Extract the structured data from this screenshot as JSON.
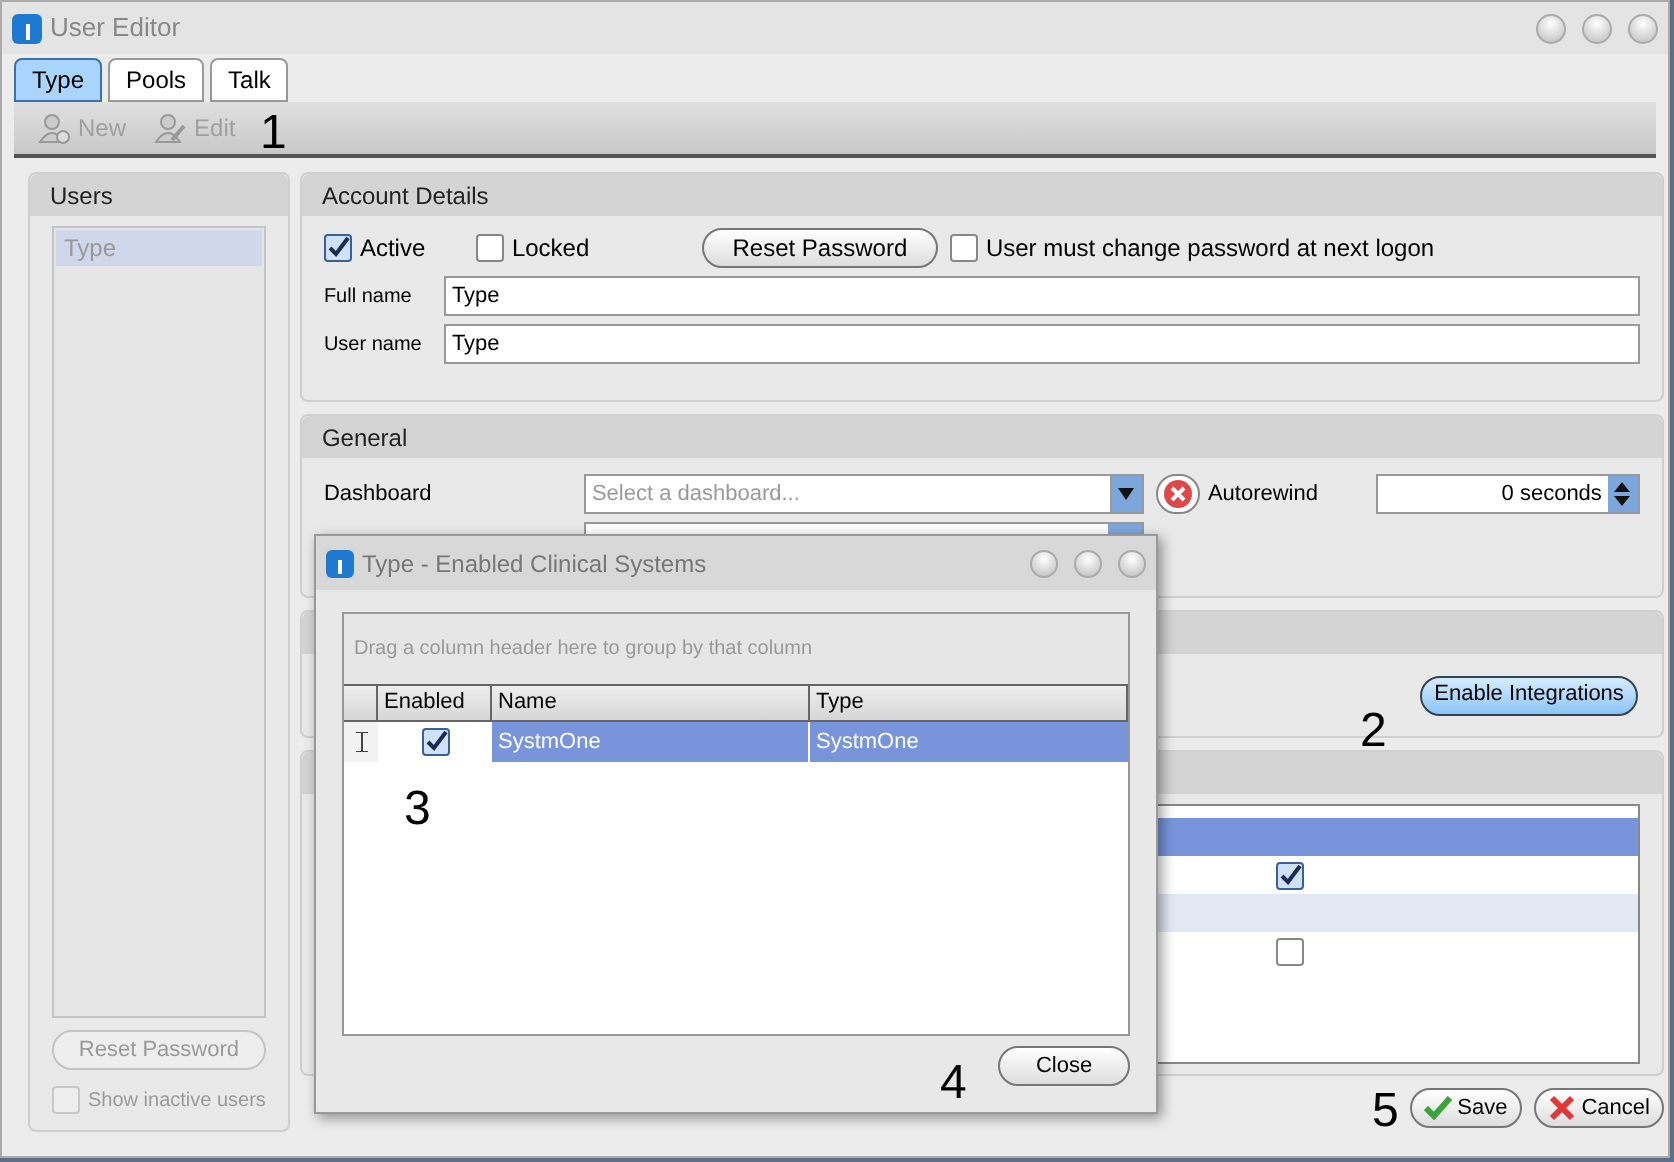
{
  "window": {
    "title": "User Editor"
  },
  "tabs": [
    {
      "label": "Type",
      "selected": true
    },
    {
      "label": "Pools",
      "selected": false
    },
    {
      "label": "Talk",
      "selected": false
    }
  ],
  "toolbar": [
    {
      "label": "New",
      "disabled": true,
      "kind": "new"
    },
    {
      "label": "Edit",
      "disabled": true,
      "kind": "edit"
    }
  ],
  "users_panel": {
    "title": "Users",
    "items": [
      {
        "label": "Type",
        "selected": true
      }
    ],
    "reset_button": {
      "label": "Reset Password",
      "disabled": true
    },
    "show_inactive": {
      "label": "Show inactive users",
      "checked": false,
      "disabled": true
    }
  },
  "account_details": {
    "title": "Account Details",
    "active": {
      "label": "Active",
      "checked": true
    },
    "locked": {
      "label": "Locked",
      "checked": false
    },
    "reset_button": "Reset Password",
    "must_change": {
      "label": "User must change password at next logon",
      "checked": false
    },
    "full_name": {
      "label": "Full name",
      "value": "Type"
    },
    "user_name": {
      "label": "User name",
      "value": "Type"
    }
  },
  "general": {
    "title": "General",
    "dashboard": {
      "label": "Dashboard",
      "placeholder": "Select a dashboard..."
    },
    "autorewind": {
      "label": "Autorewind",
      "value": "0 seconds"
    }
  },
  "integrations_panel": {
    "button": "Enable Integrations"
  },
  "systems_grid": {
    "rows": [
      {
        "selected": true,
        "kind": "empty"
      },
      {
        "selected": false,
        "kind": "checkbox",
        "checked": true
      },
      {
        "selected": false,
        "kind": "empty"
      },
      {
        "selected": false,
        "kind": "checkbox",
        "checked": false
      }
    ]
  },
  "footer": {
    "save": "Save",
    "cancel": "Cancel"
  },
  "dialog": {
    "title": "Type - Enabled Clinical Systems",
    "group_hint": "Drag a column header here to group by that column",
    "columns": [
      "Enabled",
      "Name",
      "Type"
    ],
    "rows": [
      {
        "enabled": true,
        "name": "SystmOne",
        "type": "SystmOne",
        "selected": true
      }
    ],
    "close": "Close"
  },
  "callouts": [
    "1",
    "2",
    "3",
    "4",
    "5"
  ]
}
